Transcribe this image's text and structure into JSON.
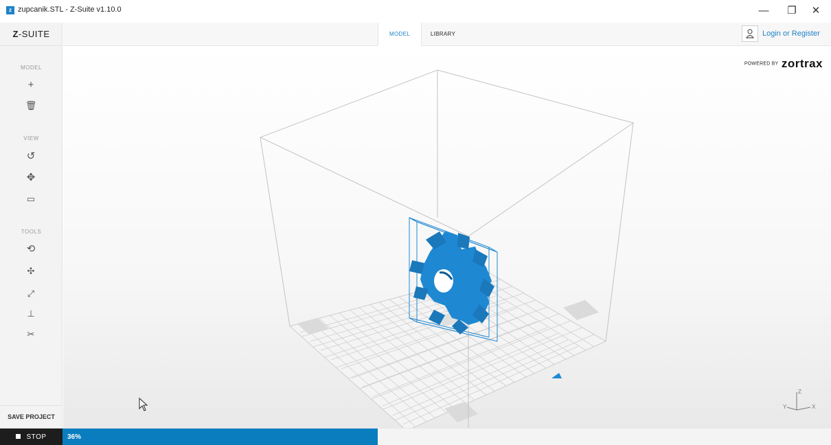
{
  "window": {
    "title": "zupcanik.STL - Z-Suite v1.10.0",
    "app_icon_letter": "z",
    "minimize_glyph": "—",
    "maximize_glyph": "❐",
    "close_glyph": "✕"
  },
  "brand": {
    "bold": "Z",
    "rest": "-SUITE"
  },
  "sidebar": {
    "sections": {
      "model": "MODEL",
      "view": "VIEW",
      "tools": "TOOLS"
    },
    "model_tools": [
      {
        "name": "add-model-icon",
        "glyph": "+"
      },
      {
        "name": "delete-model-icon",
        "glyph": "🗑"
      }
    ],
    "view_tools": [
      {
        "name": "rotate-view-icon",
        "glyph": "↺"
      },
      {
        "name": "pan-view-icon",
        "glyph": "✥"
      },
      {
        "name": "camera-view-icon",
        "glyph": "▭"
      }
    ],
    "tools": [
      {
        "name": "rotate-model-icon",
        "glyph": "⟲"
      },
      {
        "name": "move-model-icon",
        "glyph": "✣"
      },
      {
        "name": "scale-model-icon",
        "glyph": "⤢"
      },
      {
        "name": "lay-flat-icon",
        "glyph": "⊥"
      },
      {
        "name": "cut-model-icon",
        "glyph": "✂"
      }
    ],
    "save_project": "SAVE PROJECT"
  },
  "topbar": {
    "tabs": [
      {
        "label": "MODEL",
        "active": true
      },
      {
        "label": "LIBRARY",
        "active": false
      }
    ],
    "user_icon": "user-icon",
    "login_text": "Login or Register"
  },
  "viewport": {
    "powered_label": "POWERED BY",
    "powered_logo": "zortrax",
    "model_color": "#1e88d2",
    "axes": {
      "x": "X",
      "y": "Y",
      "z": "Z"
    }
  },
  "bottom": {
    "stop_label": "STOP",
    "progress_text": "36%",
    "progress_value": 0.36,
    "accent": "#0a7dbf"
  }
}
